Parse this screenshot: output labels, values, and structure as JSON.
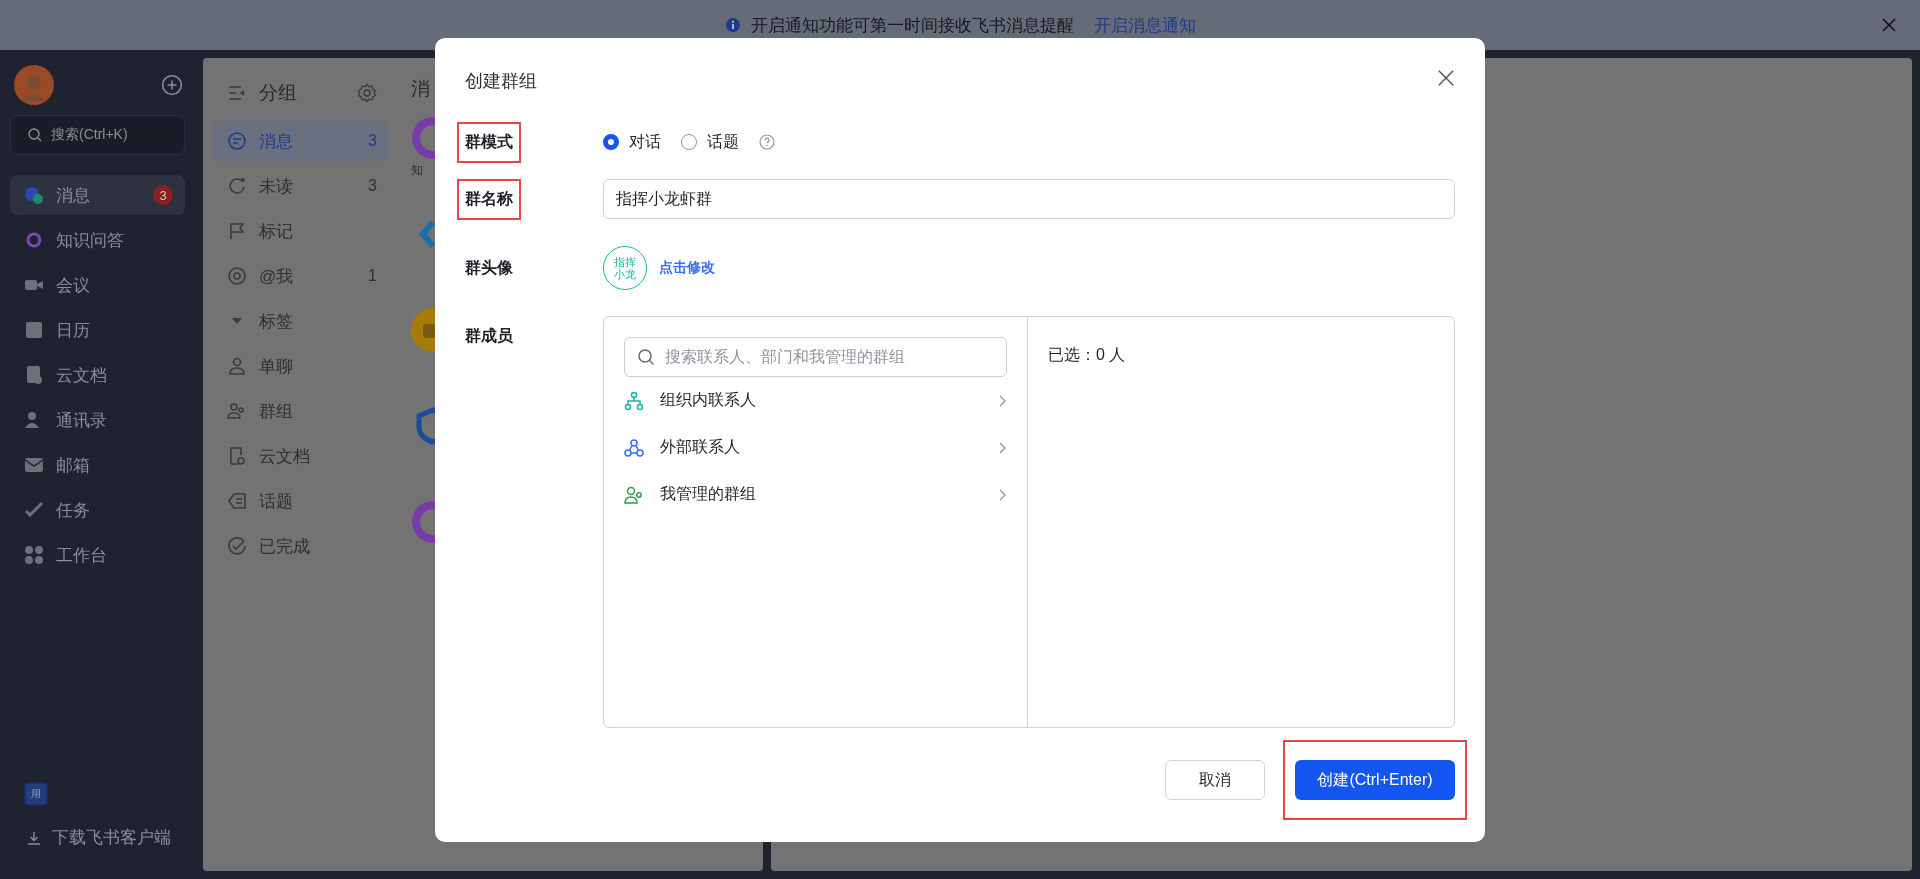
{
  "notice_bar": {
    "text": "开启通知功能可第一时间接收飞书消息提醒",
    "link": "开启消息通知"
  },
  "sidebar": {
    "search_placeholder": "搜索(Ctrl+K)",
    "items": [
      {
        "label": "消息",
        "selected": true,
        "badge": "3"
      },
      {
        "label": "知识问答",
        "selected": false
      },
      {
        "label": "会议",
        "selected": false
      },
      {
        "label": "日历",
        "selected": false
      },
      {
        "label": "云文档",
        "selected": false
      },
      {
        "label": "通讯录",
        "selected": false
      },
      {
        "label": "邮箱",
        "selected": false
      },
      {
        "label": "任务",
        "selected": false
      },
      {
        "label": "工作台",
        "selected": false
      }
    ],
    "app_badge": "用",
    "download": "下载飞书客户端"
  },
  "groups": {
    "title": "分组",
    "items": [
      {
        "label": "消息",
        "count": "3",
        "selected": true,
        "kind": "item"
      },
      {
        "label": "未读",
        "count": "3",
        "selected": false,
        "kind": "item"
      },
      {
        "label": "标记",
        "selected": false,
        "kind": "item"
      },
      {
        "label": "@我",
        "count": "1",
        "selected": false,
        "kind": "item"
      },
      {
        "label": "标签",
        "selected": false,
        "kind": "section"
      },
      {
        "label": "单聊",
        "selected": false,
        "kind": "item"
      },
      {
        "label": "群组",
        "selected": false,
        "kind": "item"
      },
      {
        "label": "云文档",
        "selected": false,
        "kind": "item"
      },
      {
        "label": "话题",
        "selected": false,
        "kind": "item"
      },
      {
        "label": "已完成",
        "selected": false,
        "kind": "item"
      }
    ]
  },
  "chat_list": {
    "title": "消",
    "items": [
      {
        "kind": "ring",
        "caption": "知"
      },
      {
        "kind": "chevron"
      },
      {
        "kind": "bot"
      },
      {
        "kind": "shield"
      },
      {
        "kind": "ring"
      }
    ]
  },
  "dialog": {
    "title": "创建群组",
    "mode": {
      "label": "群模式",
      "highlighted": true,
      "options": [
        {
          "label": "对话",
          "selected": true
        },
        {
          "label": "话题",
          "selected": false
        }
      ]
    },
    "name": {
      "label": "群名称",
      "highlighted": true,
      "value": "指挥小龙虾群"
    },
    "avatar": {
      "label": "群头像",
      "highlighted": false,
      "text": "指挥小龙",
      "edit_link": "点击修改"
    },
    "members": {
      "label": "群成员",
      "highlighted": false,
      "search_placeholder": "搜索联系人、部门和我管理的群组",
      "sources": [
        {
          "label": "组织内联系人",
          "kind": "org"
        },
        {
          "label": "外部联系人",
          "kind": "external"
        },
        {
          "label": "我管理的群组",
          "kind": "groups"
        }
      ],
      "selected_text": "已选：0 人"
    },
    "buttons": [
      {
        "label": "取消",
        "kind": "secondary"
      },
      {
        "label": "创建(Ctrl+Enter)",
        "kind": "primary",
        "highlighted": true
      }
    ]
  }
}
